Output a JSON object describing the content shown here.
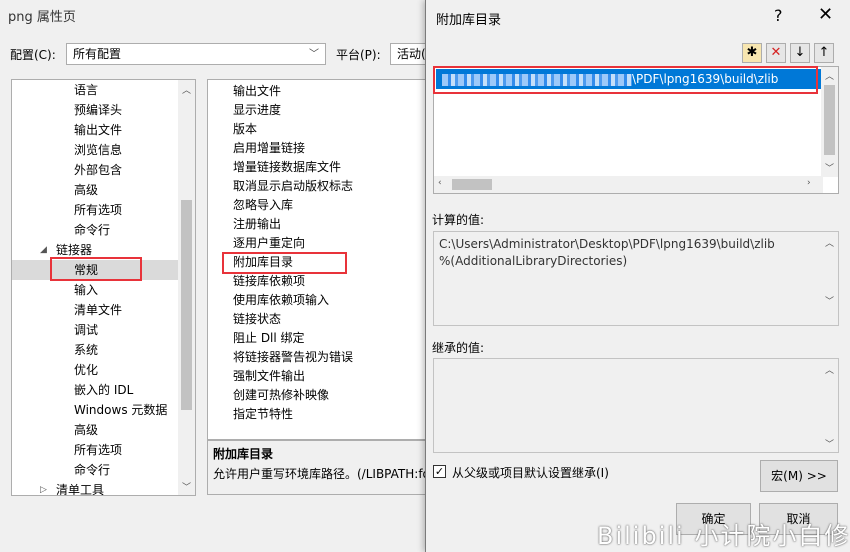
{
  "main": {
    "title": "png 属性页",
    "config_label": "配置(C):",
    "config_value": "所有配置",
    "platform_label": "平台(P):",
    "platform_value": "活动(x"
  },
  "tree": {
    "items": [
      {
        "label": "语言"
      },
      {
        "label": "预编译头"
      },
      {
        "label": "输出文件"
      },
      {
        "label": "浏览信息"
      },
      {
        "label": "外部包含"
      },
      {
        "label": "高级"
      },
      {
        "label": "所有选项"
      },
      {
        "label": "命令行"
      },
      {
        "label": "链接器"
      },
      {
        "label": "常规"
      },
      {
        "label": "输入"
      },
      {
        "label": "清单文件"
      },
      {
        "label": "调试"
      },
      {
        "label": "系统"
      },
      {
        "label": "优化"
      },
      {
        "label": "嵌入的 IDL"
      },
      {
        "label": "Windows 元数据"
      },
      {
        "label": "高级"
      },
      {
        "label": "所有选项"
      },
      {
        "label": "命令行"
      },
      {
        "label": "清单工具"
      }
    ]
  },
  "props": {
    "rows": [
      {
        "label": "输出文件"
      },
      {
        "label": "显示进度"
      },
      {
        "label": "版本"
      },
      {
        "label": "启用增量链接"
      },
      {
        "label": "增量链接数据库文件"
      },
      {
        "label": "取消显示启动版权标志"
      },
      {
        "label": "忽略导入库"
      },
      {
        "label": "注册输出"
      },
      {
        "label": "逐用户重定向"
      },
      {
        "label": "附加库目录"
      },
      {
        "label": "链接库依赖项"
      },
      {
        "label": "使用库依赖项输入"
      },
      {
        "label": "链接状态"
      },
      {
        "label": "阻止 Dll 绑定"
      },
      {
        "label": "将链接器警告视为错误"
      },
      {
        "label": "强制文件输出"
      },
      {
        "label": "创建可热修补映像"
      },
      {
        "label": "指定节特性"
      }
    ],
    "desc_title": "附加库目录",
    "desc_text": "允许用户重写环境库路径。(/LIBPATH:fo"
  },
  "dialog": {
    "title": "附加库目录",
    "help": "?",
    "close": "✕",
    "list_entry_visible": "\\PDF\\lpng1639\\build\\zlib",
    "calc_label": "计算的值:",
    "calc_line1": "C:\\Users\\Administrator\\Desktop\\PDF\\lpng1639\\build\\zlib",
    "calc_line2": "%(AdditionalLibraryDirectories)",
    "inherited_label": "继承的值:",
    "inherit_checkbox": "从父级或项目默认设置继承(I)",
    "macro_button": "宏(M) >>",
    "ok_button": "确定",
    "cancel_button": "取消"
  },
  "watermark": "Bilibili 小计院小白修"
}
